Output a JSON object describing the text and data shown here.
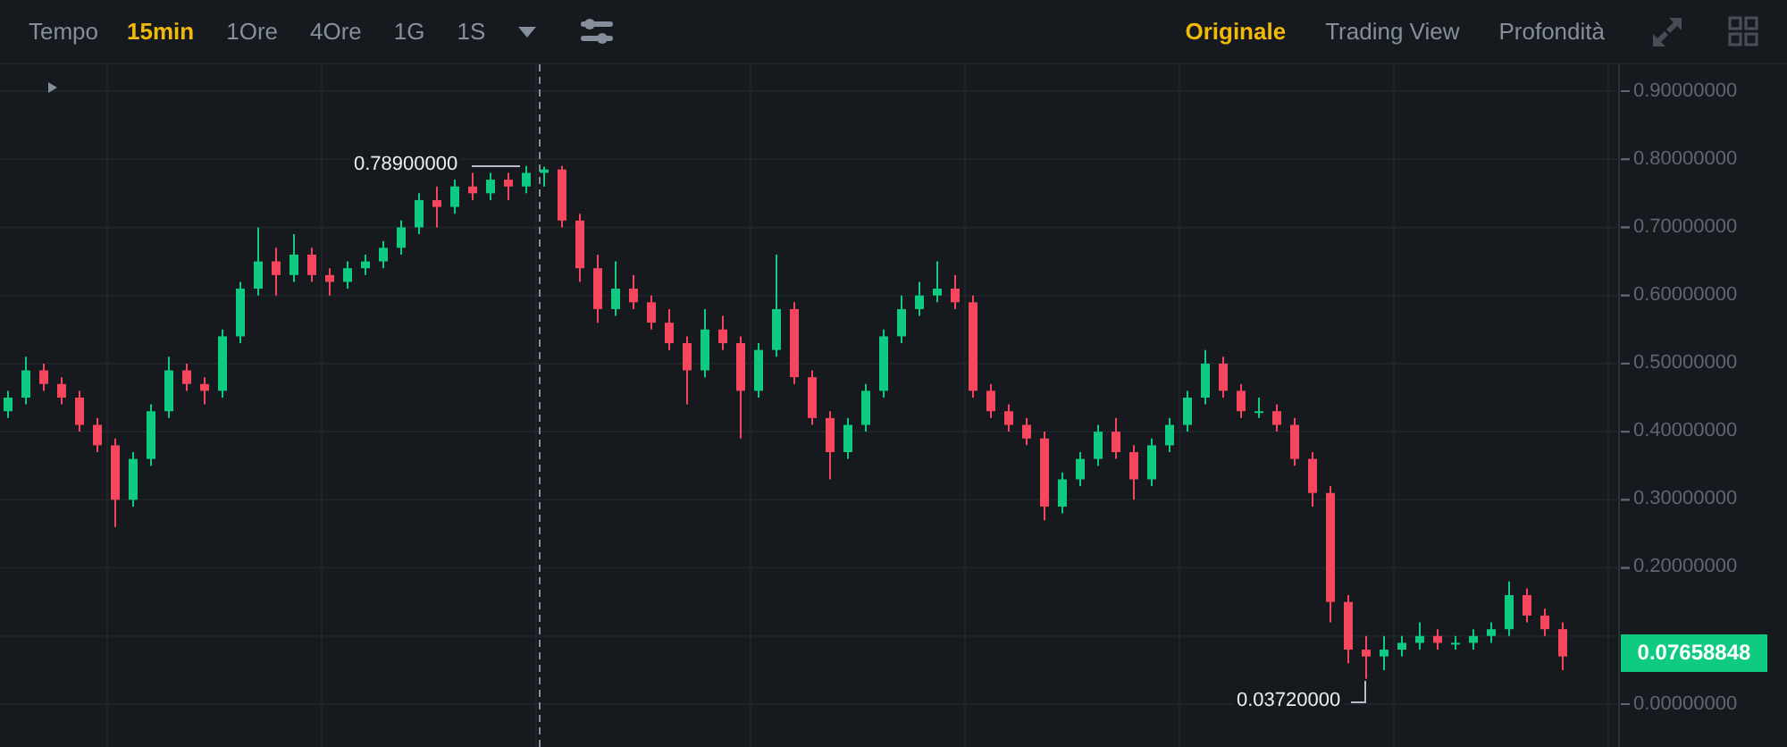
{
  "toolbar": {
    "time_label": "Tempo",
    "intervals": [
      {
        "label": "15min",
        "selected": true
      },
      {
        "label": "1Ore",
        "selected": false
      },
      {
        "label": "4Ore",
        "selected": false
      },
      {
        "label": "1G",
        "selected": false
      },
      {
        "label": "1S",
        "selected": false
      }
    ],
    "views": [
      {
        "label": "Originale",
        "selected": true
      },
      {
        "label": "Trading View",
        "selected": false
      },
      {
        "label": "Profondità",
        "selected": false
      }
    ]
  },
  "chart": {
    "chart_data": {
      "type": "candlestick",
      "ylim": [
        0,
        0.9
      ],
      "yticks": [
        {
          "value": 0.9,
          "label": "0.90000000"
        },
        {
          "value": 0.8,
          "label": "0.80000000"
        },
        {
          "value": 0.7,
          "label": "0.70000000"
        },
        {
          "value": 0.6,
          "label": "0.60000000"
        },
        {
          "value": 0.5,
          "label": "0.50000000"
        },
        {
          "value": 0.4,
          "label": "0.40000000"
        },
        {
          "value": 0.3,
          "label": "0.30000000"
        },
        {
          "value": 0.2,
          "label": "0.20000000"
        },
        {
          "value": 0,
          "label": "0.00000000"
        }
      ],
      "grid": true,
      "ohlc": [
        [
          0.43,
          0.46,
          0.42,
          0.45
        ],
        [
          0.45,
          0.51,
          0.44,
          0.49
        ],
        [
          0.49,
          0.5,
          0.46,
          0.47
        ],
        [
          0.47,
          0.48,
          0.44,
          0.45
        ],
        [
          0.45,
          0.46,
          0.4,
          0.41
        ],
        [
          0.41,
          0.42,
          0.37,
          0.38
        ],
        [
          0.38,
          0.39,
          0.26,
          0.3
        ],
        [
          0.3,
          0.37,
          0.29,
          0.36
        ],
        [
          0.36,
          0.44,
          0.35,
          0.43
        ],
        [
          0.43,
          0.51,
          0.42,
          0.49
        ],
        [
          0.49,
          0.5,
          0.46,
          0.47
        ],
        [
          0.47,
          0.48,
          0.44,
          0.46
        ],
        [
          0.46,
          0.55,
          0.45,
          0.54
        ],
        [
          0.54,
          0.62,
          0.53,
          0.61
        ],
        [
          0.61,
          0.7,
          0.6,
          0.65
        ],
        [
          0.65,
          0.67,
          0.6,
          0.63
        ],
        [
          0.63,
          0.69,
          0.62,
          0.66
        ],
        [
          0.66,
          0.67,
          0.62,
          0.63
        ],
        [
          0.63,
          0.64,
          0.6,
          0.62
        ],
        [
          0.62,
          0.65,
          0.61,
          0.64
        ],
        [
          0.64,
          0.66,
          0.63,
          0.65
        ],
        [
          0.65,
          0.68,
          0.64,
          0.67
        ],
        [
          0.67,
          0.71,
          0.66,
          0.7
        ],
        [
          0.7,
          0.75,
          0.69,
          0.74
        ],
        [
          0.74,
          0.76,
          0.7,
          0.73
        ],
        [
          0.73,
          0.77,
          0.72,
          0.76
        ],
        [
          0.76,
          0.78,
          0.74,
          0.75
        ],
        [
          0.75,
          0.78,
          0.74,
          0.77
        ],
        [
          0.77,
          0.78,
          0.74,
          0.76
        ],
        [
          0.76,
          0.79,
          0.75,
          0.78
        ],
        [
          0.78,
          0.789,
          0.76,
          0.785
        ],
        [
          0.785,
          0.79,
          0.7,
          0.71
        ],
        [
          0.71,
          0.72,
          0.62,
          0.64
        ],
        [
          0.64,
          0.66,
          0.56,
          0.58
        ],
        [
          0.58,
          0.65,
          0.57,
          0.61
        ],
        [
          0.61,
          0.63,
          0.58,
          0.59
        ],
        [
          0.59,
          0.6,
          0.55,
          0.56
        ],
        [
          0.56,
          0.58,
          0.52,
          0.53
        ],
        [
          0.53,
          0.54,
          0.44,
          0.49
        ],
        [
          0.49,
          0.58,
          0.48,
          0.55
        ],
        [
          0.55,
          0.57,
          0.52,
          0.53
        ],
        [
          0.53,
          0.54,
          0.39,
          0.46
        ],
        [
          0.46,
          0.53,
          0.45,
          0.52
        ],
        [
          0.52,
          0.66,
          0.51,
          0.58
        ],
        [
          0.58,
          0.59,
          0.47,
          0.48
        ],
        [
          0.48,
          0.49,
          0.41,
          0.42
        ],
        [
          0.42,
          0.43,
          0.33,
          0.37
        ],
        [
          0.37,
          0.42,
          0.36,
          0.41
        ],
        [
          0.41,
          0.47,
          0.4,
          0.46
        ],
        [
          0.46,
          0.55,
          0.45,
          0.54
        ],
        [
          0.54,
          0.6,
          0.53,
          0.58
        ],
        [
          0.58,
          0.62,
          0.57,
          0.6
        ],
        [
          0.6,
          0.65,
          0.59,
          0.61
        ],
        [
          0.61,
          0.63,
          0.58,
          0.59
        ],
        [
          0.59,
          0.6,
          0.45,
          0.46
        ],
        [
          0.46,
          0.47,
          0.42,
          0.43
        ],
        [
          0.43,
          0.44,
          0.4,
          0.41
        ],
        [
          0.41,
          0.42,
          0.38,
          0.39
        ],
        [
          0.39,
          0.4,
          0.27,
          0.29
        ],
        [
          0.29,
          0.34,
          0.28,
          0.33
        ],
        [
          0.33,
          0.37,
          0.32,
          0.36
        ],
        [
          0.36,
          0.41,
          0.35,
          0.4
        ],
        [
          0.4,
          0.42,
          0.36,
          0.37
        ],
        [
          0.37,
          0.38,
          0.3,
          0.33
        ],
        [
          0.33,
          0.39,
          0.32,
          0.38
        ],
        [
          0.38,
          0.42,
          0.37,
          0.41
        ],
        [
          0.41,
          0.46,
          0.4,
          0.45
        ],
        [
          0.45,
          0.52,
          0.44,
          0.5
        ],
        [
          0.5,
          0.51,
          0.45,
          0.46
        ],
        [
          0.46,
          0.47,
          0.42,
          0.43
        ],
        [
          0.43,
          0.45,
          0.42,
          0.43
        ],
        [
          0.43,
          0.44,
          0.4,
          0.41
        ],
        [
          0.41,
          0.42,
          0.35,
          0.36
        ],
        [
          0.36,
          0.37,
          0.29,
          0.31
        ],
        [
          0.31,
          0.32,
          0.12,
          0.15
        ],
        [
          0.15,
          0.16,
          0.06,
          0.08
        ],
        [
          0.08,
          0.1,
          0.0372,
          0.07
        ],
        [
          0.07,
          0.1,
          0.05,
          0.08
        ],
        [
          0.08,
          0.1,
          0.07,
          0.09
        ],
        [
          0.09,
          0.12,
          0.08,
          0.1
        ],
        [
          0.1,
          0.11,
          0.08,
          0.09
        ],
        [
          0.09,
          0.1,
          0.08,
          0.09
        ],
        [
          0.09,
          0.11,
          0.08,
          0.1
        ],
        [
          0.1,
          0.12,
          0.09,
          0.11
        ],
        [
          0.11,
          0.18,
          0.1,
          0.16
        ],
        [
          0.16,
          0.17,
          0.12,
          0.13
        ],
        [
          0.13,
          0.14,
          0.1,
          0.11
        ],
        [
          0.11,
          0.12,
          0.05,
          0.07
        ]
      ]
    },
    "high_marker": "0.78900000",
    "low_marker": "0.03720000",
    "last_price": "0.07658848"
  }
}
